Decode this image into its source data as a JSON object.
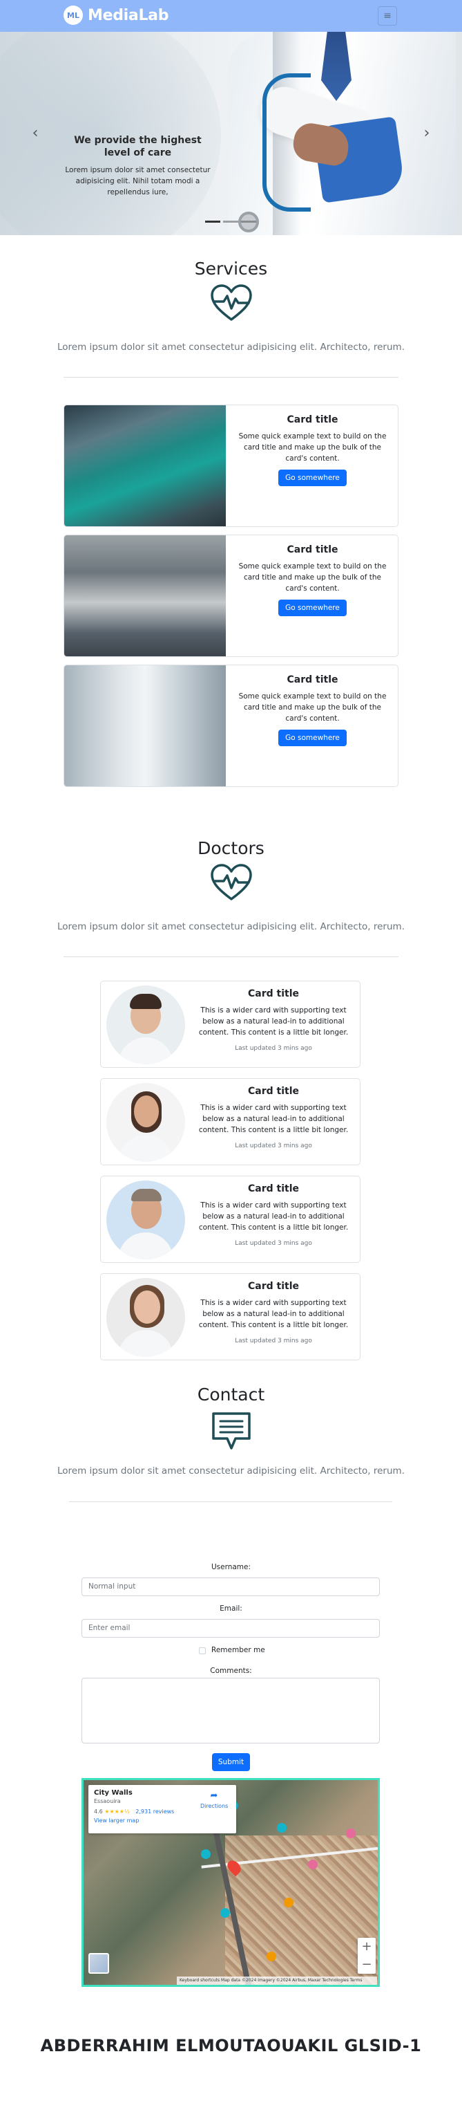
{
  "navbar": {
    "logo_text": "ML",
    "brand": "MediaLab",
    "toggler_icon": "≡"
  },
  "hero": {
    "title": "We provide the highest level of care",
    "text": "Lorem ipsum dolor sit amet consectetur adipisicing elit. Nihil totam modi a repellendus iure,",
    "prev_icon": "‹",
    "next_icon": "›",
    "slides_count": 3,
    "active_slide": 1
  },
  "services": {
    "title": "Services",
    "icon": "heartbeat-icon",
    "lede": "Lorem ipsum dolor sit amet consectetur adipisicing elit. Architecto, rerum.",
    "cards": [
      {
        "title": "Card title",
        "text": "Some quick example text to build on the card title and make up the bulk of the card's content.",
        "button": "Go somewhere"
      },
      {
        "title": "Card title",
        "text": "Some quick example text to build on the card title and make up the bulk of the card's content.",
        "button": "Go somewhere"
      },
      {
        "title": "Card title",
        "text": "Some quick example text to build on the card title and make up the bulk of the card's content.",
        "button": "Go somewhere"
      }
    ]
  },
  "doctors": {
    "title": "Doctors",
    "icon": "heartbeat-icon",
    "lede": "Lorem ipsum dolor sit amet consectetur adipisicing elit. Architecto, rerum.",
    "cards": [
      {
        "title": "Card title",
        "text": "This is a wider card with supporting text below as a natural lead-in to additional content. This content is a little bit longer.",
        "meta": "Last updated 3 mins ago"
      },
      {
        "title": "Card title",
        "text": "This is a wider card with supporting text below as a natural lead-in to additional content. This content is a little bit longer.",
        "meta": "Last updated 3 mins ago"
      },
      {
        "title": "Card title",
        "text": "This is a wider card with supporting text below as a natural lead-in to additional content. This content is a little bit longer.",
        "meta": "Last updated 3 mins ago"
      },
      {
        "title": "Card title",
        "text": "This is a wider card with supporting text below as a natural lead-in to additional content. This content is a little bit longer.",
        "meta": "Last updated 3 mins ago"
      }
    ]
  },
  "contact": {
    "title": "Contact",
    "icon": "message-icon",
    "lede": "Lorem ipsum dolor sit amet consectetur adipisicing elit. Architecto, rerum.",
    "username_label": "Username:",
    "username_placeholder": "Normal input",
    "email_label": "Email:",
    "email_placeholder": "Enter email",
    "remember_label": "Remember me",
    "comments_label": "Comments:",
    "submit": "Submit"
  },
  "map": {
    "place": "City Walls",
    "address": "Essaouira",
    "rating": "4.6",
    "stars": "★★★★½",
    "reviews": "2,931 reviews",
    "larger_map": "View larger map",
    "directions": "Directions",
    "zoom_in": "+",
    "zoom_out": "−",
    "footer": "Keyboard shortcuts   Map data ©2024 Imagery ©2024 Airbus, Maxar Technologies   Terms"
  },
  "footer": {
    "name": "ABDERRAHIM ELMOUTAOUAKIL GLSID-1"
  },
  "colors": {
    "navbar": "#8fb7f9",
    "primary": "#0d6efd",
    "icon_teal": "#1e4d56",
    "map_border": "#3fe0c0"
  }
}
